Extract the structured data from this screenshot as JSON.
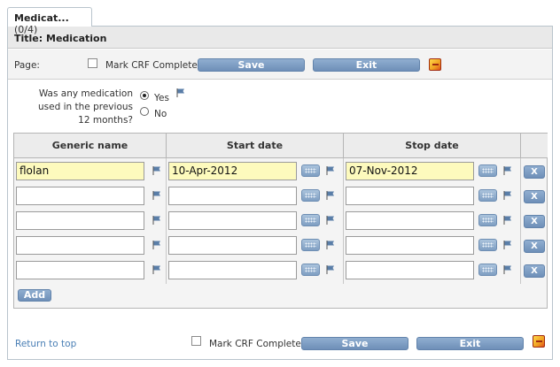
{
  "tab": {
    "name": "Medicat...",
    "count": "(0/4)"
  },
  "form": {
    "title": "Title: Medication"
  },
  "page_bar": {
    "page_label": "Page:",
    "mark_crf_label": "Mark CRF Complete",
    "save_label": "Save",
    "exit_label": "Exit"
  },
  "question": {
    "line1": "Was any medication",
    "line2": "used in the previous",
    "line3": "12 months?",
    "yes_label": "Yes",
    "no_label": "No",
    "selected": "Yes"
  },
  "table": {
    "headers": [
      "Generic name",
      "Start date",
      "Stop date"
    ],
    "rows": [
      {
        "generic_name": "flolan",
        "start_date": "10-Apr-2012",
        "stop_date": "07-Nov-2012"
      },
      {
        "generic_name": "",
        "start_date": "",
        "stop_date": ""
      },
      {
        "generic_name": "",
        "start_date": "",
        "stop_date": ""
      },
      {
        "generic_name": "",
        "start_date": "",
        "stop_date": ""
      },
      {
        "generic_name": "",
        "start_date": "",
        "stop_date": ""
      }
    ],
    "remove_label": "X",
    "add_label": "Add"
  },
  "footer": {
    "return_link": "Return to top",
    "mark_crf_label": "Mark CRF Complete",
    "save_label": "Save",
    "exit_label": "Exit"
  },
  "colors": {
    "button": "#7a99c0",
    "filled_input": "#fdfabd",
    "link": "#4a7fb5",
    "flag": "#5a7ea8"
  },
  "icons": [
    "flag-icon",
    "calendar-icon",
    "mark-icon"
  ]
}
